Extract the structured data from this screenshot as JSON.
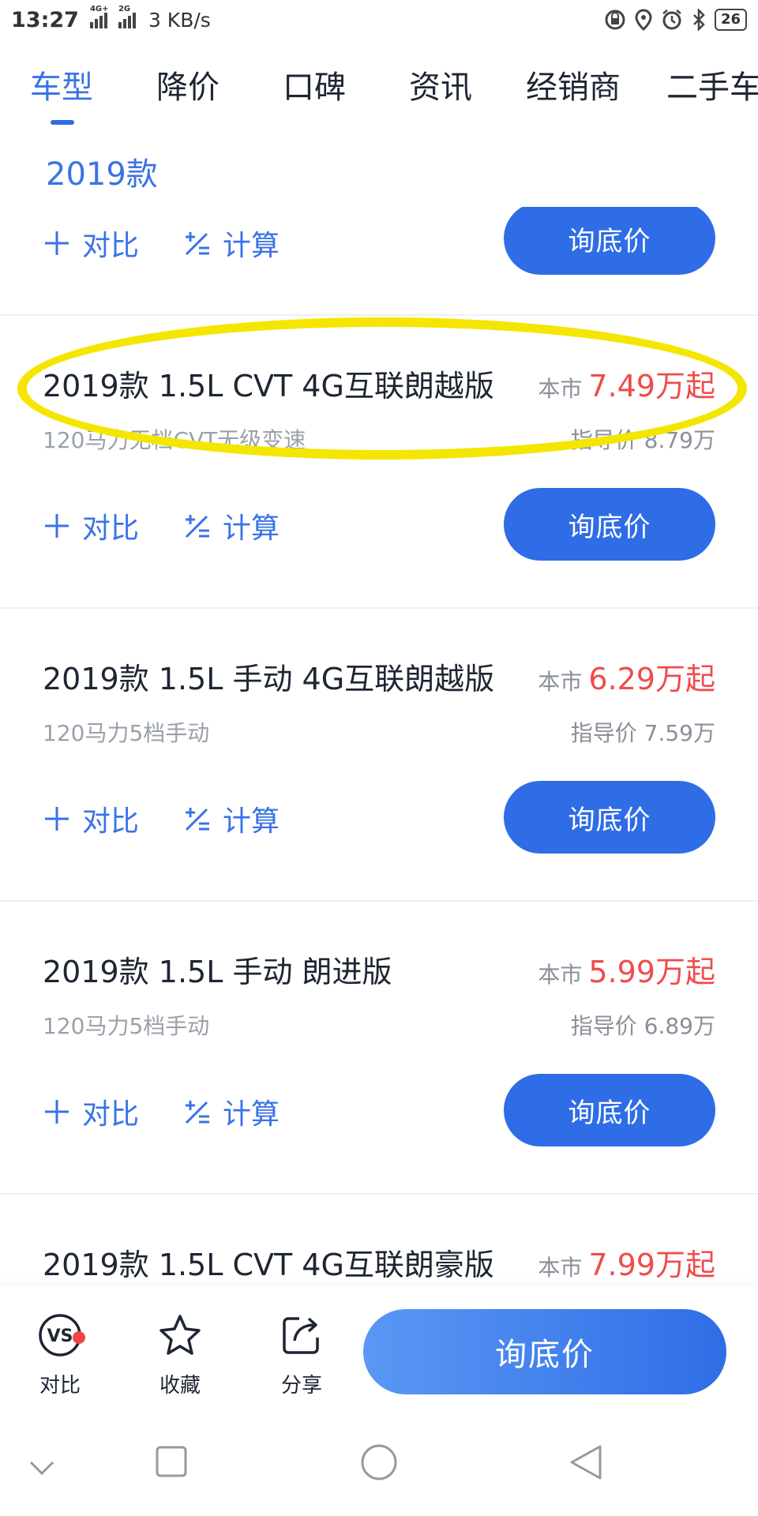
{
  "status_bar": {
    "time": "13:27",
    "network1": "4G+",
    "network2": "2G",
    "speed": "3 KB/s",
    "battery": "26"
  },
  "tabs": [
    {
      "label": "车型",
      "active": true
    },
    {
      "label": "降价"
    },
    {
      "label": "口碑"
    },
    {
      "label": "资讯"
    },
    {
      "label": "经销商"
    },
    {
      "label": "二手车"
    }
  ],
  "section": {
    "year": "2019款"
  },
  "actions": {
    "compare": "对比",
    "calc": "计算",
    "inquire": "询底价"
  },
  "cards": [
    {
      "title": "2019款 1.5L CVT 4G互联朗越版",
      "price_prefix": "本市",
      "price": "7.49万起",
      "sub": "120马力无档CVT无级变速",
      "guide": "指导价 8.79万"
    },
    {
      "title": "2019款 1.5L 手动 4G互联朗越版",
      "price_prefix": "本市",
      "price": "6.29万起",
      "sub": "120马力5档手动",
      "guide": "指导价 7.59万"
    },
    {
      "title": "2019款 1.5L 手动 朗进版",
      "price_prefix": "本市",
      "price": "5.99万起",
      "sub": "120马力5档手动",
      "guide": "指导价 6.89万"
    },
    {
      "title": "2019款 1.5L CVT 4G互联朗豪版",
      "price_prefix": "本市",
      "price": "7.99万起"
    }
  ],
  "bottom_bar": {
    "compare": "对比",
    "favorite": "收藏",
    "share": "分享",
    "cta": "询底价"
  },
  "colors": {
    "accent": "#2f6de6",
    "price_red": "#ef4c4c",
    "highlight": "#f4e600"
  }
}
